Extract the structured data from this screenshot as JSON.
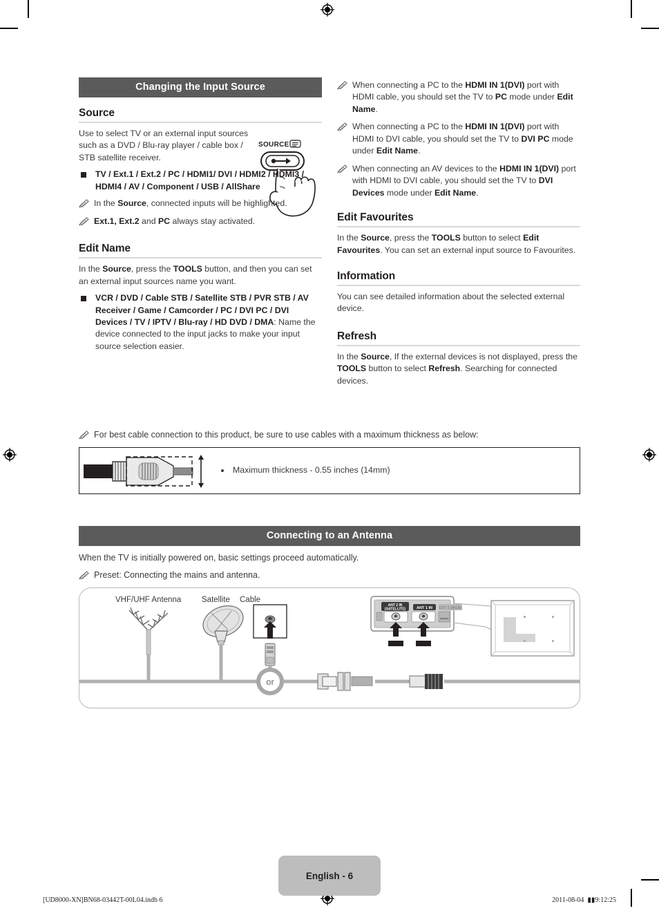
{
  "document": {
    "page_label": "English - 6",
    "footer_left": "[UD8000-XN]BN68-03442T-00L04.indb   6",
    "footer_right_date": "2011-08-04",
    "footer_right_time": "9:12:25",
    "band_color": "#5b5b5b",
    "page_tag_color": "#bdbdbd"
  },
  "section_input_source": {
    "band_title": "Changing the Input Source",
    "source": {
      "heading": "Source",
      "intro": "Use to select TV or an external input sources such as a DVD / Blu-ray player / cable box / STB satellite receiver.",
      "bullet_bold": "TV / Ext.1 / Ext.2 / PC / HDMI1/ DVI / HDMI2 / HDMI3 / HDMI4 / AV / Component / USB / AllShare",
      "note_1_pre": "In the ",
      "note_1_bold": "Source",
      "note_1_post": ", connected inputs will be highlighted.",
      "note_2_bold": "Ext.1, Ext.2",
      "note_2_mid": " and ",
      "note_2_bold2": "PC",
      "note_2_post": " always stay activated.",
      "button_art_label": "SOURCE"
    },
    "edit_name": {
      "heading": "Edit Name",
      "intro_pre": "In the ",
      "intro_bold1": "Source",
      "intro_mid": ", press the ",
      "intro_bold2": "TOOLS",
      "intro_post": " button, and then you can set an external input sources name you want.",
      "bullet_bold": "VCR / DVD / Cable STB / Satellite STB / PVR STB / AV Receiver / Game / Camcorder / PC / DVI PC / DVI Devices / TV / IPTV / Blu-ray / HD DVD / DMA",
      "bullet_rest": ": Name the device connected to the input jacks to make your input source selection easier."
    },
    "notes_right": [
      {
        "parts": [
          {
            "t": "When connecting a PC to the ",
            "b": false
          },
          {
            "t": "HDMI IN 1(DVI)",
            "b": true
          },
          {
            "t": " port with HDMI cable, you should set the TV to ",
            "b": false
          },
          {
            "t": "PC",
            "b": true
          },
          {
            "t": " mode under ",
            "b": false
          },
          {
            "t": "Edit Name",
            "b": true
          },
          {
            "t": ".",
            "b": false
          }
        ]
      },
      {
        "parts": [
          {
            "t": "When connecting a PC to the ",
            "b": false
          },
          {
            "t": "HDMI IN 1(DVI)",
            "b": true
          },
          {
            "t": " port with HDMI to DVI cable, you should set the TV to ",
            "b": false
          },
          {
            "t": "DVI PC",
            "b": true
          },
          {
            "t": " mode under ",
            "b": false
          },
          {
            "t": "Edit Name",
            "b": true
          },
          {
            "t": ".",
            "b": false
          }
        ]
      },
      {
        "parts": [
          {
            "t": "When connecting an AV devices to the ",
            "b": false
          },
          {
            "t": "HDMI IN 1(DVI)",
            "b": true
          },
          {
            "t": " port with HDMI to DVI cable, you should set the TV to ",
            "b": false
          },
          {
            "t": "DVI Devices",
            "b": true
          },
          {
            "t": " mode under ",
            "b": false
          },
          {
            "t": "Edit Name",
            "b": true
          },
          {
            "t": ".",
            "b": false
          }
        ]
      }
    ],
    "edit_favourites": {
      "heading": "Edit Favourites",
      "parts": [
        {
          "t": "In the ",
          "b": false
        },
        {
          "t": "Source",
          "b": true
        },
        {
          "t": ", press the ",
          "b": false
        },
        {
          "t": "TOOLS",
          "b": true
        },
        {
          "t": " button to select ",
          "b": false
        },
        {
          "t": "Edit Favourites",
          "b": true
        },
        {
          "t": ". You can set an external input source to Favourites.",
          "b": false
        }
      ]
    },
    "information": {
      "heading": "Information",
      "parts": [
        {
          "t": "You can see detailed information about the selected external device.",
          "b": false
        }
      ]
    },
    "refresh": {
      "heading": "Refresh",
      "parts": [
        {
          "t": "In the ",
          "b": false
        },
        {
          "t": "Source",
          "b": true
        },
        {
          "t": ", If the external devices is not displayed, press the ",
          "b": false
        },
        {
          "t": "TOOLS",
          "b": true
        },
        {
          "t": " button to select ",
          "b": false
        },
        {
          "t": "Refresh",
          "b": true
        },
        {
          "t": ". Searching for connected devices.",
          "b": false
        }
      ]
    }
  },
  "cable_thickness": {
    "note": "For best cable connection to  this product, be sure to use cables with a maximum thickness as below:",
    "bullet": "Maximum thickness - 0.55 inches (14mm)"
  },
  "section_antenna": {
    "band_title": "Connecting to an Antenna",
    "line1": "When the TV is initially powered on, basic settings proceed automatically.",
    "note1": "Preset: Connecting the mains and antenna.",
    "diagram": {
      "label_vhf": "VHF/UHF Antenna",
      "label_satellite": "Satellite",
      "label_cable": "Cable",
      "label_or": "or",
      "port_ant2": "ANT 2 IN",
      "port_ant2_sub": "(SATELLITE)",
      "port_ant1": "ANT 1 IN",
      "port_ext1": "EXT 1 (RGB)"
    }
  }
}
